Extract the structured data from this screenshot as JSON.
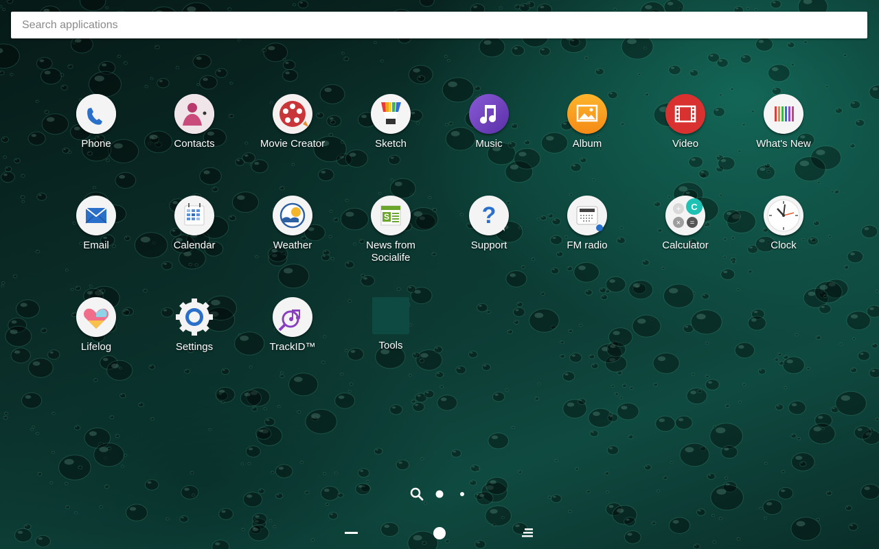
{
  "search": {
    "placeholder": "Search applications"
  },
  "apps": [
    {
      "label": "Phone",
      "icon": "phone-icon"
    },
    {
      "label": "Contacts",
      "icon": "contacts-icon"
    },
    {
      "label": "Movie Creator",
      "icon": "movie-creator-icon"
    },
    {
      "label": "Sketch",
      "icon": "sketch-icon"
    },
    {
      "label": "Music",
      "icon": "music-icon"
    },
    {
      "label": "Album",
      "icon": "album-icon"
    },
    {
      "label": "Video",
      "icon": "video-icon"
    },
    {
      "label": "What's New",
      "icon": "whats-new-icon"
    },
    {
      "label": "Email",
      "icon": "email-icon"
    },
    {
      "label": "Calendar",
      "icon": "calendar-icon"
    },
    {
      "label": "Weather",
      "icon": "weather-icon"
    },
    {
      "label": "News from\nSocialife",
      "icon": "socialife-icon"
    },
    {
      "label": "Support",
      "icon": "support-icon"
    },
    {
      "label": "FM radio",
      "icon": "fm-radio-icon"
    },
    {
      "label": "Calculator",
      "icon": "calculator-icon"
    },
    {
      "label": "Clock",
      "icon": "clock-icon"
    },
    {
      "label": "Lifelog",
      "icon": "lifelog-icon"
    },
    {
      "label": "Settings",
      "icon": "settings-icon"
    },
    {
      "label": "TrackID™",
      "icon": "trackid-icon"
    },
    {
      "label": "Tools",
      "icon": "folder-icon"
    }
  ],
  "pager": {
    "pages": 2,
    "current": 1
  },
  "nav": {
    "back": "back-icon",
    "home": "home-icon",
    "recents": "recents-icon"
  },
  "colors": {
    "wallpaper": "#0f4a40",
    "accent": "#1b6fd1"
  }
}
